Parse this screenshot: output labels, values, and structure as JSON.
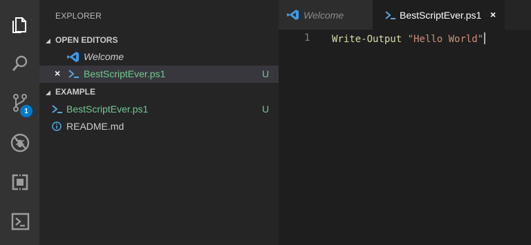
{
  "activity_bar": {
    "icons": [
      "files-icon",
      "search-icon",
      "source-control-icon",
      "debug-icon",
      "extensions-icon",
      "powershell-icon"
    ],
    "source_control_badge": "1",
    "badge_color": "#007acc"
  },
  "sidebar": {
    "title": "EXPLORER",
    "open_editors": {
      "label": "OPEN EDITORS",
      "items": [
        {
          "icon": "vscode-icon",
          "name": "Welcome",
          "italic": true
        },
        {
          "icon": "powershell-file-icon",
          "name": "BestScriptEver.ps1",
          "close_glyph": "×",
          "git_status": "U"
        }
      ]
    },
    "folder": {
      "label": "EXAMPLE",
      "items": [
        {
          "icon": "powershell-file-icon",
          "name": "BestScriptEver.ps1",
          "git_status": "U"
        },
        {
          "icon": "info-icon",
          "name": "README.md"
        }
      ]
    }
  },
  "tabs": [
    {
      "label": "Welcome",
      "icon": "vscode-icon",
      "active": false,
      "italic": true
    },
    {
      "label": "BestScriptEver.ps1",
      "icon": "powershell-file-icon",
      "active": true,
      "close_glyph": "×"
    }
  ],
  "editor": {
    "line_number": "1",
    "code_cmd": "Write-Output",
    "code_space": " ",
    "code_string": "\"Hello World\""
  },
  "colors": {
    "untracked": "#73c991",
    "accent": "#007acc",
    "string": "#ce9178",
    "function": "#dcdcaa"
  }
}
